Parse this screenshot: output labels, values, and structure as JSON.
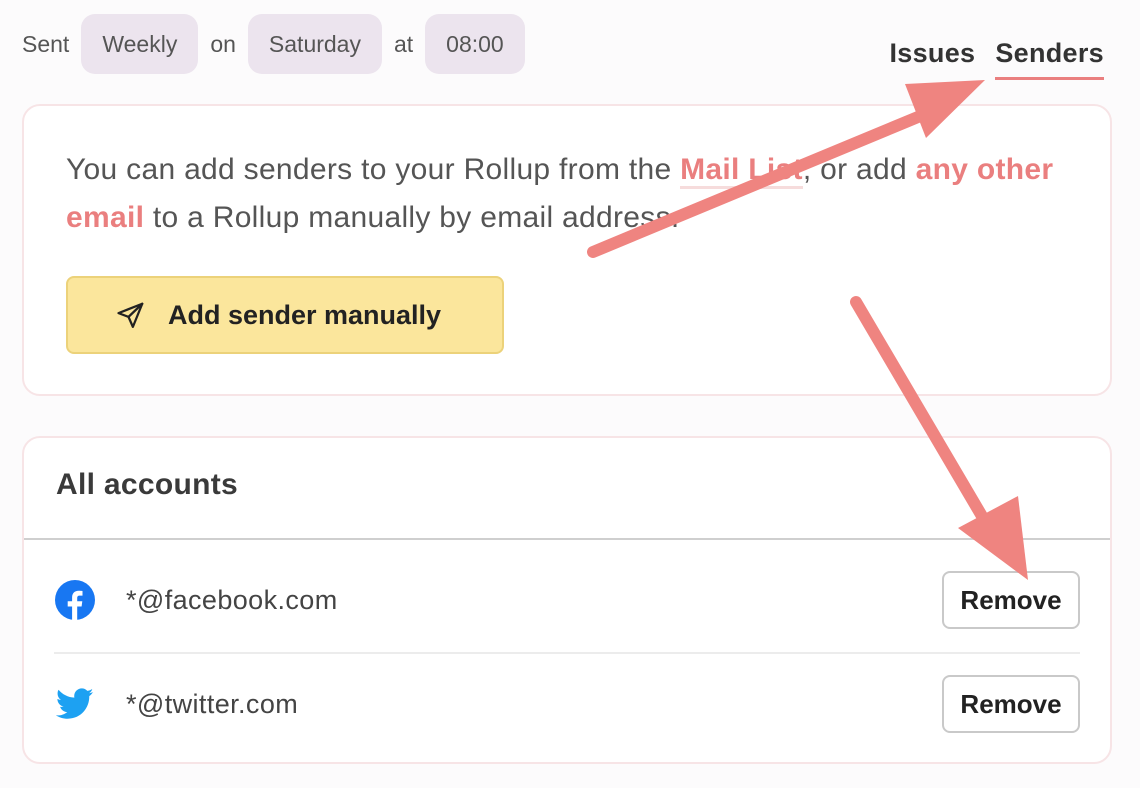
{
  "schedule": {
    "sent_label": "Sent",
    "frequency": "Weekly",
    "on_label": "on",
    "day": "Saturday",
    "at_label": "at",
    "time": "08:00"
  },
  "tabs": [
    {
      "label": "Issues",
      "active": false
    },
    {
      "label": "Senders",
      "active": true
    }
  ],
  "info": {
    "part1": "You can add senders to your Rollup from the ",
    "mail_list_link": "Mail List",
    "part2": ", or add ",
    "other_email_link": "any other email",
    "part3": " to a Rollup manually by email address."
  },
  "add_button": {
    "label": "Add sender manually",
    "icon": "send-icon"
  },
  "accounts": {
    "title": "All accounts",
    "items": [
      {
        "address": "*@facebook.com",
        "icon": "facebook-icon",
        "action": "Remove"
      },
      {
        "address": "*@twitter.com",
        "icon": "twitter-icon",
        "action": "Remove"
      }
    ]
  },
  "colors": {
    "accent": "#ea7f7f",
    "button_yellow": "#fbe69c",
    "pill_bg": "#ece4ee",
    "facebook": "#1877f2",
    "twitter": "#1da1f2"
  }
}
